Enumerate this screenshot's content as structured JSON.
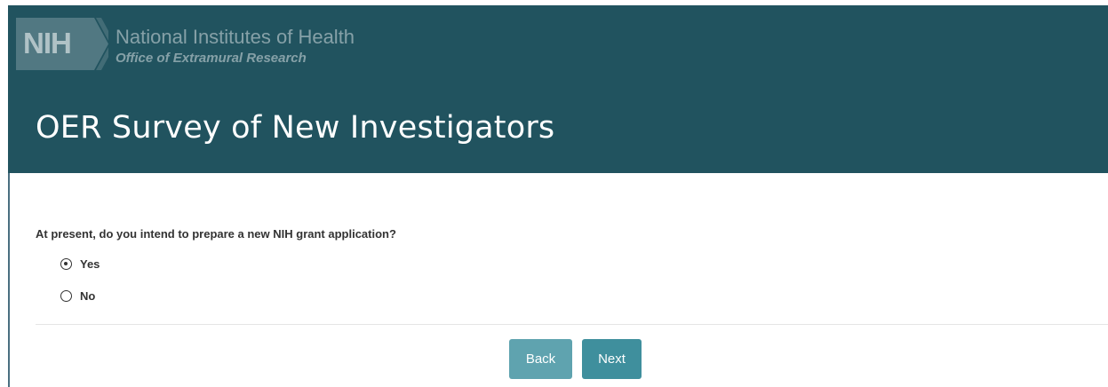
{
  "header": {
    "logo_text": "NIH",
    "org_name": "National Institutes of Health",
    "org_sub": "Office of Extramural Research",
    "title": "OER Survey of New Investigators"
  },
  "form": {
    "question": "At present, do you intend to prepare a new NIH grant application?",
    "options": [
      {
        "label": "Yes",
        "selected": true
      },
      {
        "label": "No",
        "selected": false
      }
    ]
  },
  "nav": {
    "back_label": "Back",
    "next_label": "Next"
  },
  "colors": {
    "header_bg": "#21535f",
    "button_bg": "#4a98a6"
  }
}
